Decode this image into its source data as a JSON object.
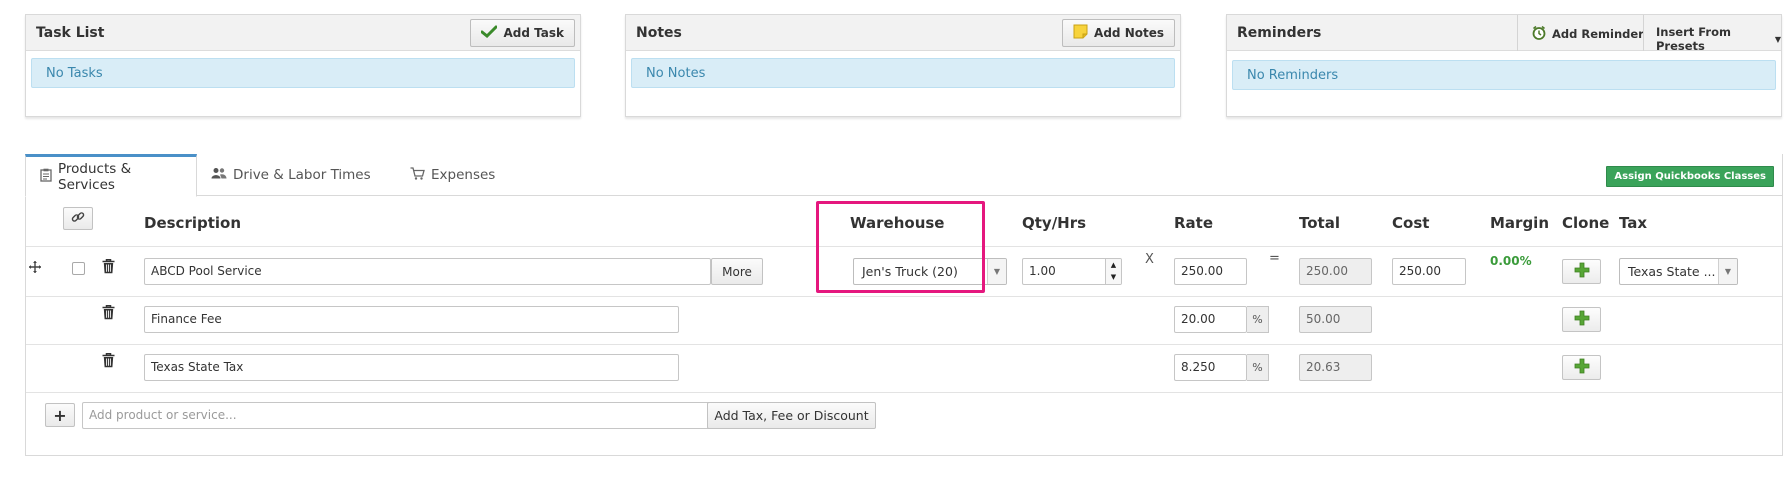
{
  "task_panel": {
    "title": "Task List",
    "add_label": "Add Task",
    "empty_text": "No Tasks"
  },
  "notes_panel": {
    "title": "Notes",
    "add_label": "Add Notes",
    "empty_text": "No Notes"
  },
  "reminders_panel": {
    "title": "Reminders",
    "add_label": "Add Reminder",
    "presets_label": "Insert From Presets",
    "empty_text": "No Reminders"
  },
  "tabs": [
    {
      "label": "Products & Services",
      "icon": "clipboard-icon",
      "active": true
    },
    {
      "label": "Drive & Labor Times",
      "icon": "users-icon",
      "active": false
    },
    {
      "label": "Expenses",
      "icon": "cart-icon",
      "active": false
    }
  ],
  "assign_button": "Assign Quickbooks Classes",
  "columns": {
    "description": "Description",
    "warehouse": "Warehouse",
    "qty": "Qty/Hrs",
    "rate": "Rate",
    "total": "Total",
    "cost": "Cost",
    "margin": "Margin",
    "clone": "Clone",
    "tax": "Tax"
  },
  "rows": [
    {
      "description": "ABCD Pool Service",
      "more_label": "More",
      "warehouse": "Jen's Truck (20)",
      "qty": "1.00",
      "times": "X",
      "rate": "250.00",
      "equals": "=",
      "total": "250.00",
      "cost": "250.00",
      "margin": "0.00%",
      "tax": "Texas State ..."
    },
    {
      "description": "Finance Fee",
      "rate": "20.00",
      "rate_unit": "%",
      "total": "50.00"
    },
    {
      "description": "Texas State Tax",
      "rate": "8.250",
      "rate_unit": "%",
      "total": "20.63"
    }
  ],
  "footer": {
    "add_symbol": "+",
    "add_placeholder": "Add product or service...",
    "add_tax_label": "Add Tax, Fee or Discount"
  },
  "colors": {
    "highlight": "#e5177e",
    "margin_text": "#3a9b3a",
    "info_bg": "#d9edf7",
    "info_text": "#3a87ad",
    "assign_bg": "#3aa35a",
    "active_tab": "#4a90c8"
  }
}
